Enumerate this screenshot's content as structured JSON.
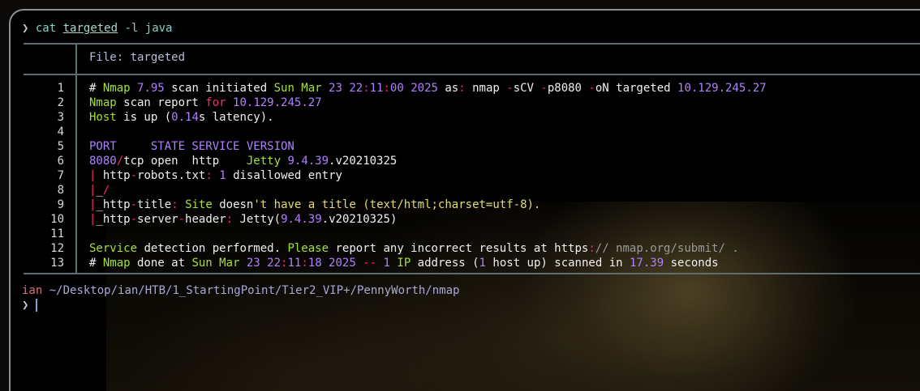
{
  "command": {
    "arrow": "❯",
    "cmd": "cat",
    "arg": "targeted",
    "flags": "-l java"
  },
  "file_header": {
    "label": "File: ",
    "name": "targeted"
  },
  "line_numbers": [
    "1",
    "2",
    "3",
    "4",
    "5",
    "6",
    "7",
    "8",
    "9",
    "10",
    "11",
    "12",
    "13"
  ],
  "lines": [
    [
      [
        "w",
        "# "
      ],
      [
        "g",
        "Nmap"
      ],
      [
        "w",
        " "
      ],
      [
        "p",
        "7.95"
      ],
      [
        "w",
        " scan initiated "
      ],
      [
        "g",
        "Sun Mar "
      ],
      [
        "p",
        "23 22"
      ],
      [
        "r",
        ":"
      ],
      [
        "p",
        "11"
      ],
      [
        "r",
        ":"
      ],
      [
        "p",
        "00 2025"
      ],
      [
        "w",
        " as"
      ],
      [
        "r",
        ":"
      ],
      [
        "w",
        " nmap "
      ],
      [
        "r",
        "-"
      ],
      [
        "w",
        "sCV "
      ],
      [
        "r",
        "-"
      ],
      [
        "w",
        "p8080 "
      ],
      [
        "r",
        "-"
      ],
      [
        "w",
        "oN targeted "
      ],
      [
        "p",
        "10.129.245.27"
      ]
    ],
    [
      [
        "g",
        "Nmap"
      ],
      [
        "w",
        " scan report "
      ],
      [
        "r",
        "for"
      ],
      [
        "w",
        " "
      ],
      [
        "p",
        "10.129.245.27"
      ]
    ],
    [
      [
        "g",
        "Host"
      ],
      [
        "w",
        " is up ("
      ],
      [
        "p",
        "0.14"
      ],
      [
        "w",
        "s latency)."
      ]
    ],
    [],
    [
      [
        "p",
        "PORT     STATE SERVICE VERSION"
      ]
    ],
    [
      [
        "p",
        "8080"
      ],
      [
        "r",
        "/"
      ],
      [
        "w",
        "tcp open  http    "
      ],
      [
        "g",
        "Jetty"
      ],
      [
        "w",
        " "
      ],
      [
        "p",
        "9.4.39"
      ],
      [
        "w",
        ".v20210325"
      ]
    ],
    [
      [
        "r",
        "|"
      ],
      [
        "w",
        " http"
      ],
      [
        "r",
        "-"
      ],
      [
        "w",
        "robots.txt"
      ],
      [
        "r",
        ":"
      ],
      [
        "w",
        " "
      ],
      [
        "p",
        "1"
      ],
      [
        "w",
        " disallowed entry"
      ]
    ],
    [
      [
        "r",
        "|"
      ],
      [
        "w",
        "_"
      ],
      [
        "r",
        "/"
      ]
    ],
    [
      [
        "r",
        "|"
      ],
      [
        "w",
        "_http"
      ],
      [
        "r",
        "-"
      ],
      [
        "w",
        "title"
      ],
      [
        "r",
        ":"
      ],
      [
        "w",
        " "
      ],
      [
        "g",
        "Site"
      ],
      [
        "w",
        " doesn"
      ],
      [
        "y",
        "'t have a title (text/html;charset=utf-8)."
      ]
    ],
    [
      [
        "r",
        "|"
      ],
      [
        "w",
        "_http"
      ],
      [
        "r",
        "-"
      ],
      [
        "w",
        "server"
      ],
      [
        "r",
        "-"
      ],
      [
        "w",
        "header"
      ],
      [
        "r",
        ":"
      ],
      [
        "w",
        " Jetty("
      ],
      [
        "p",
        "9.4.39"
      ],
      [
        "w",
        ".v20210325)"
      ]
    ],
    [],
    [
      [
        "g",
        "Service"
      ],
      [
        "w",
        " detection performed. "
      ],
      [
        "g",
        "Please"
      ],
      [
        "w",
        " report any incorrect results at https"
      ],
      [
        "r",
        ":"
      ],
      [
        "dim",
        "// nmap.org/submit/ ."
      ]
    ],
    [
      [
        "w",
        "# "
      ],
      [
        "g",
        "Nmap"
      ],
      [
        "w",
        " done at "
      ],
      [
        "g",
        "Sun Mar "
      ],
      [
        "p",
        "23 22"
      ],
      [
        "r",
        ":"
      ],
      [
        "p",
        "11"
      ],
      [
        "r",
        ":"
      ],
      [
        "p",
        "18 2025"
      ],
      [
        "w",
        " "
      ],
      [
        "r",
        "--"
      ],
      [
        "w",
        " "
      ],
      [
        "p",
        "1"
      ],
      [
        "w",
        " "
      ],
      [
        "g",
        "IP"
      ],
      [
        "w",
        " address ("
      ],
      [
        "p",
        "1"
      ],
      [
        "w",
        " host up) scanned in "
      ],
      [
        "p",
        "17.39"
      ],
      [
        "w",
        " seconds"
      ]
    ]
  ],
  "prompt": {
    "user": "ian",
    "path": " ~/Desktop/ian/HTB/1_StartingPoint/Tier2_VIP+/PennyWorth/nmap",
    "arrow": "❯"
  }
}
